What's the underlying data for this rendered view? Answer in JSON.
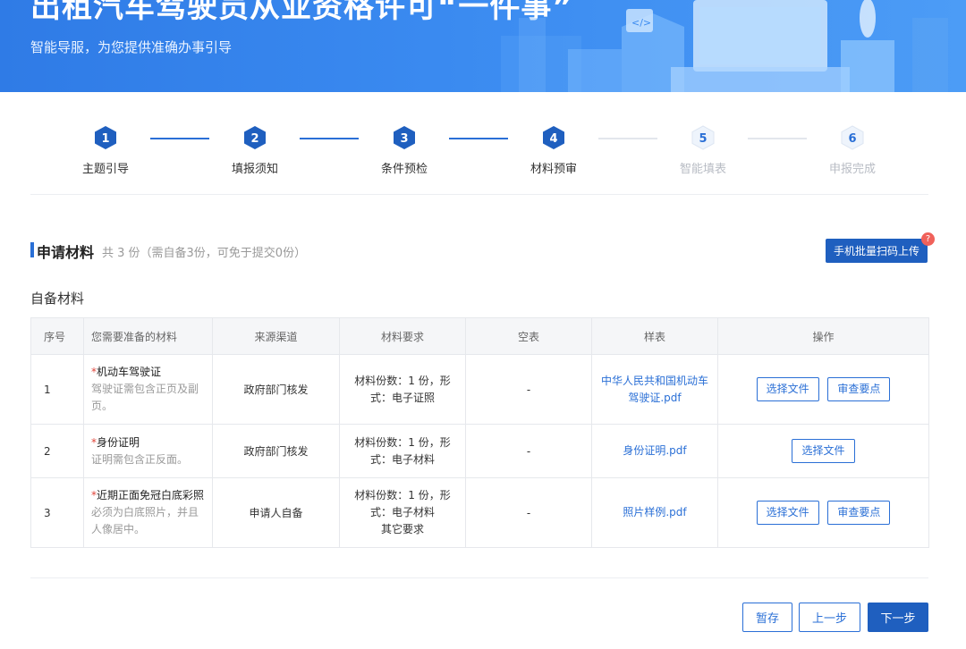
{
  "banner": {
    "title": "出租汽车驾驶员从业资格许可“一件事”",
    "subtitle": "智能导服，为您提供准确办事引导"
  },
  "steps": [
    {
      "num": "1",
      "label": "主题引导",
      "state": "done"
    },
    {
      "num": "2",
      "label": "填报须知",
      "state": "done"
    },
    {
      "num": "3",
      "label": "条件预检",
      "state": "done"
    },
    {
      "num": "4",
      "label": "材料预审",
      "state": "current"
    },
    {
      "num": "5",
      "label": "智能填表",
      "state": "todo"
    },
    {
      "num": "6",
      "label": "申报完成",
      "state": "todo"
    }
  ],
  "section": {
    "title": "申请材料",
    "count_text": "共 3 份（需自备3份，可免于提交0份）",
    "scan_button": "手机批量扫码上传",
    "scan_badge": "?",
    "self_title": "自备材料"
  },
  "table": {
    "headers": [
      "序号",
      "您需要准备的材料",
      "来源渠道",
      "材料要求",
      "空表",
      "样表",
      "操作"
    ],
    "rows": [
      {
        "index": "1",
        "name": "机动车驾驶证",
        "note": "驾驶证需包含正页及副页。",
        "source": "政府部门核发",
        "req_line1": "材料份数：1 份，形",
        "req_line2": "式：电子证照",
        "req_line3": "",
        "blank": "-",
        "sample": "中华人民共和国机动车驾驶证.pdf",
        "btn_select": "选择文件",
        "btn_review": "审查要点"
      },
      {
        "index": "2",
        "name": "身份证明",
        "note": "证明需包含正反面。",
        "source": "政府部门核发",
        "req_line1": "材料份数：1 份，形",
        "req_line2": "式：电子材料",
        "req_line3": "",
        "blank": "-",
        "sample": "身份证明.pdf",
        "btn_select": "选择文件",
        "btn_review": ""
      },
      {
        "index": "3",
        "name": "近期正面免冠白底彩照",
        "note": "必须为白底照片，并且人像居中。",
        "source": "申请人自备",
        "req_line1": "材料份数：1 份，形",
        "req_line2": "式：电子材料",
        "req_line3": "其它要求",
        "blank": "-",
        "sample": "照片样例.pdf",
        "btn_select": "选择文件",
        "btn_review": "审查要点"
      }
    ],
    "required_mark": "*"
  },
  "footer": {
    "save": "暂存",
    "prev": "上一步",
    "next": "下一步"
  },
  "colors": {
    "primary": "#2a6fd6",
    "primary_dark": "#1f5fbf",
    "inactive": "#b8bcc4",
    "required": "#e0453a",
    "badge": "#f0615a"
  }
}
